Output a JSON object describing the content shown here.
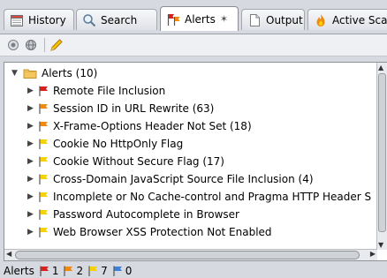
{
  "tabs": [
    {
      "label": "History",
      "icon": "history-icon",
      "active": false
    },
    {
      "label": "Search",
      "icon": "search-icon",
      "active": false
    },
    {
      "label": "Alerts",
      "icon": "alert-flags-icon",
      "active": true,
      "pin_glyph": "✶"
    },
    {
      "label": "Output",
      "icon": "output-page-icon",
      "active": false
    },
    {
      "label": "Active Sca",
      "icon": "flame-icon",
      "active": false
    }
  ],
  "toolbar": {
    "buttons": [
      {
        "icon": "view-option-icon"
      },
      {
        "icon": "globe-icon"
      },
      {
        "icon": "pencil-icon"
      }
    ]
  },
  "tree": {
    "root": {
      "label": "Alerts (10)",
      "expanded": true
    },
    "items": [
      {
        "label": "Remote File Inclusion",
        "risk": "high"
      },
      {
        "label": "Session ID in URL Rewrite (63)",
        "risk": "medium"
      },
      {
        "label": "X-Frame-Options Header Not Set (18)",
        "risk": "medium"
      },
      {
        "label": "Cookie No HttpOnly Flag",
        "risk": "low"
      },
      {
        "label": "Cookie Without Secure Flag (17)",
        "risk": "low"
      },
      {
        "label": "Cross-Domain JavaScript Source File Inclusion (4)",
        "risk": "low"
      },
      {
        "label": "Incomplete or No Cache-control and Pragma HTTP Header S",
        "risk": "low"
      },
      {
        "label": "Password Autocomplete in Browser",
        "risk": "low"
      },
      {
        "label": "Web Browser XSS Protection Not Enabled",
        "risk": "low"
      }
    ]
  },
  "status_bar": {
    "label": "Alerts",
    "counts": [
      {
        "risk": "high",
        "value": "1"
      },
      {
        "risk": "medium",
        "value": "2"
      },
      {
        "risk": "low",
        "value": "7"
      },
      {
        "risk": "info",
        "value": "0"
      }
    ]
  },
  "colors": {
    "high": "#d9201a",
    "medium": "#f08a10",
    "low": "#f5d200",
    "info": "#3e7fd8"
  }
}
